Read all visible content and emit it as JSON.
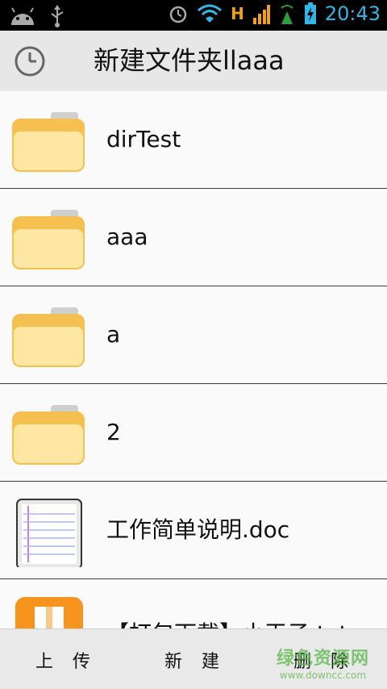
{
  "status_bar": {
    "network_label": "H",
    "time": "20:43"
  },
  "header": {
    "title": "新建文件夹llaaa"
  },
  "files": [
    {
      "name": "dirTest",
      "icon": "folder-icon"
    },
    {
      "name": "aaa",
      "icon": "folder-icon"
    },
    {
      "name": "a",
      "icon": "folder-icon"
    },
    {
      "name": "2",
      "icon": "folder-icon"
    },
    {
      "name": "工作简单说明.doc",
      "icon": "document-icon"
    },
    {
      "name": "【打包下载】小王子.txt",
      "icon": "zip-archive-icon"
    }
  ],
  "toolbar": {
    "upload_label": "上传",
    "new_label": "新建",
    "delete_label": "删除"
  },
  "watermark": {
    "main": "绿色资源网",
    "sub": "www.downcc.com"
  },
  "colors": {
    "status_accent": "#33b5e5",
    "folder_yellow": "#fcd36a",
    "archive_orange": "#f7941d",
    "watermark_green": "#59b84a"
  }
}
